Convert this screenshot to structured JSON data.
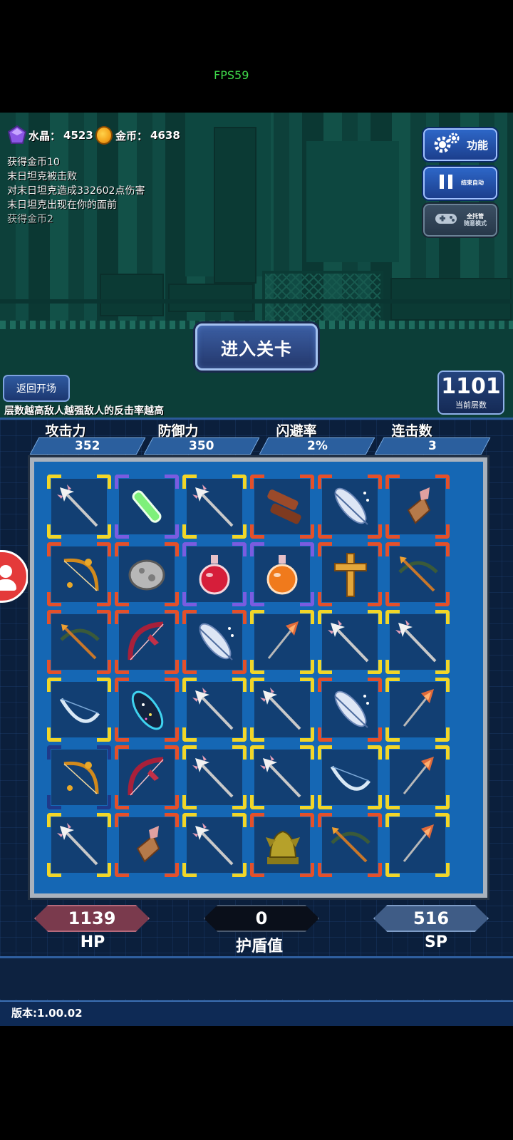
{
  "status": {
    "fps": "FPS59"
  },
  "resources": {
    "crystal_label": "水晶：",
    "crystal_value": "4523",
    "gold_label": "金币：",
    "gold_value": "4638"
  },
  "combat_log": [
    "获得金币10",
    "末日坦克被击败",
    "对末日坦克造成332602点伤害",
    "末日坦克出现在你的面前",
    "获得金币2"
  ],
  "side_buttons": {
    "function": "功能",
    "end_auto": "结束自动",
    "full_auto": "全托管",
    "full_auto_sub": "随意模式"
  },
  "main": {
    "enter_level": "进入关卡",
    "back_to_start": "返回开场",
    "floor_number": "1101",
    "floor_label": "当前层数",
    "tip": "层数越高敌人越强敌人的反击率越高"
  },
  "stats": [
    {
      "label": "攻击力",
      "value": "352"
    },
    {
      "label": "防御力",
      "value": "350"
    },
    {
      "label": "闪避率",
      "value": "2%"
    },
    {
      "label": "连击数",
      "value": "3"
    }
  ],
  "board": {
    "rows": [
      [
        {
          "item": "arrow",
          "rarity": "yellow"
        },
        {
          "item": "green-vial",
          "rarity": "purple"
        },
        {
          "item": "arrow",
          "rarity": "yellow"
        },
        {
          "item": "leather-scroll",
          "rarity": "red"
        },
        {
          "item": "feather",
          "rarity": "red"
        },
        {
          "item": "torch-bundle",
          "rarity": "red"
        }
      ],
      [
        {
          "item": "golden-bow",
          "rarity": "red"
        },
        {
          "item": "moon-rock",
          "rarity": "red"
        },
        {
          "item": "red-potion",
          "rarity": "purple"
        },
        {
          "item": "orange-potion",
          "rarity": "purple"
        },
        {
          "item": "golden-cross",
          "rarity": "red"
        },
        {
          "item": "crossbow",
          "rarity": "red"
        }
      ],
      [
        {
          "item": "crossbow",
          "rarity": "red"
        },
        {
          "item": "crimson-bow",
          "rarity": "red"
        },
        {
          "item": "feather",
          "rarity": "red"
        },
        {
          "item": "fire-arrow",
          "rarity": "yellow"
        },
        {
          "item": "arrow",
          "rarity": "yellow"
        },
        {
          "item": "arrow",
          "rarity": "yellow"
        }
      ],
      [
        {
          "item": "ice-bow",
          "rarity": "yellow"
        },
        {
          "item": "star-gem",
          "rarity": "red"
        },
        {
          "item": "arrow",
          "rarity": "yellow"
        },
        {
          "item": "arrow",
          "rarity": "yellow"
        },
        {
          "item": "feather",
          "rarity": "red"
        },
        {
          "item": "fire-arrow",
          "rarity": "yellow"
        }
      ],
      [
        {
          "item": "golden-bow",
          "rarity": "navy"
        },
        {
          "item": "crimson-bow",
          "rarity": "red"
        },
        {
          "item": "arrow",
          "rarity": "yellow"
        },
        {
          "item": "arrow",
          "rarity": "yellow"
        },
        {
          "item": "ice-bow",
          "rarity": "yellow"
        },
        {
          "item": "fire-arrow",
          "rarity": "yellow"
        }
      ],
      [
        {
          "item": "arrow",
          "rarity": "yellow"
        },
        {
          "item": "torch-bundle",
          "rarity": "red"
        },
        {
          "item": "arrow",
          "rarity": "yellow"
        },
        {
          "item": "gargoyle-statue",
          "rarity": "red"
        },
        {
          "item": "crossbow",
          "rarity": "red"
        },
        {
          "item": "fire-arrow",
          "rarity": "yellow"
        }
      ]
    ]
  },
  "vitals": {
    "hp_value": "1139",
    "hp_label": "HP",
    "shield_value": "0",
    "shield_label": "护盾值",
    "sp_value": "516",
    "sp_label": "SP"
  },
  "footer": {
    "version": "版本:1.00.02"
  },
  "colors": {
    "yellow": "#f2d628",
    "purple": "#7a5ce0",
    "red": "#e4502a",
    "navy": "#1f3a8a",
    "hp_bar": "#7a3a4d",
    "sp_bar": "#3f5c86"
  }
}
